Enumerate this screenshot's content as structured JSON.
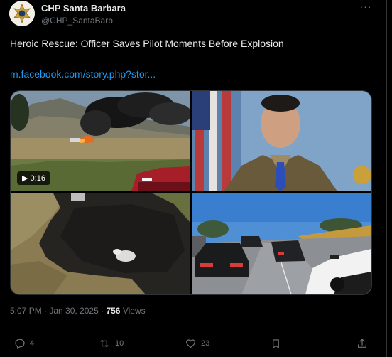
{
  "account": {
    "name": "CHP Santa Barbara",
    "handle": "@CHP_SantaBarb"
  },
  "post": {
    "title": "Heroic Rescue: Officer Saves Pilot Moments Before Explosion",
    "link": "m.facebook.com/story.php?stor..."
  },
  "media": {
    "video_duration": "0:16"
  },
  "meta": {
    "time": "5:07 PM",
    "date": "Jan 30, 2025",
    "views_count": "756",
    "views_label": "Views"
  },
  "actions": {
    "replies": "4",
    "reposts": "10",
    "likes": "23"
  },
  "colors": {
    "accent": "#1d9bf0",
    "muted": "#71767b",
    "text": "#e7e9ea"
  }
}
